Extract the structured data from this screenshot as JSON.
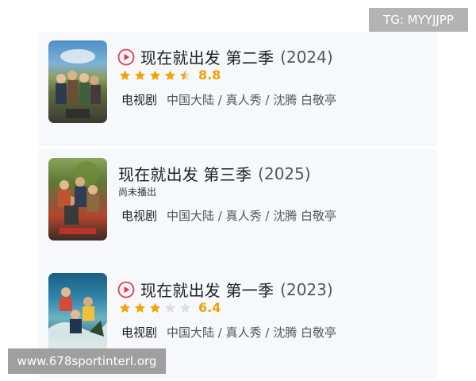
{
  "badges": {
    "tg": "TG: MYYJJPP",
    "watermark": "www.678sportinterl.org"
  },
  "colors": {
    "star_filled": "#f5a300",
    "star_empty": "#dedede",
    "play_accent": "#e8394a",
    "card_bg": "#f6f8fc"
  },
  "shows": [
    {
      "title": "现在就出发 第二季",
      "year": "(2024)",
      "playable": true,
      "rating_stars": 4.5,
      "score": "8.8",
      "status": "",
      "type": "电视剧",
      "info": "中国大陆 / 真人秀 / 沈腾 白敬亭",
      "poster_icon": "poster-image"
    },
    {
      "title": "现在就出发 第三季",
      "year": "(2025)",
      "playable": false,
      "rating_stars": null,
      "score": "",
      "status": "尚未播出",
      "type": "电视剧",
      "info": "中国大陆 / 真人秀 / 沈腾 白敬亭",
      "poster_icon": "poster-image"
    },
    {
      "title": "现在就出发 第一季",
      "year": "(2023)",
      "playable": true,
      "rating_stars": 3,
      "score": "6.4",
      "status": "",
      "type": "电视剧",
      "info": "中国大陆 / 真人秀 / 沈腾 白敬亭",
      "poster_icon": "poster-image"
    }
  ]
}
